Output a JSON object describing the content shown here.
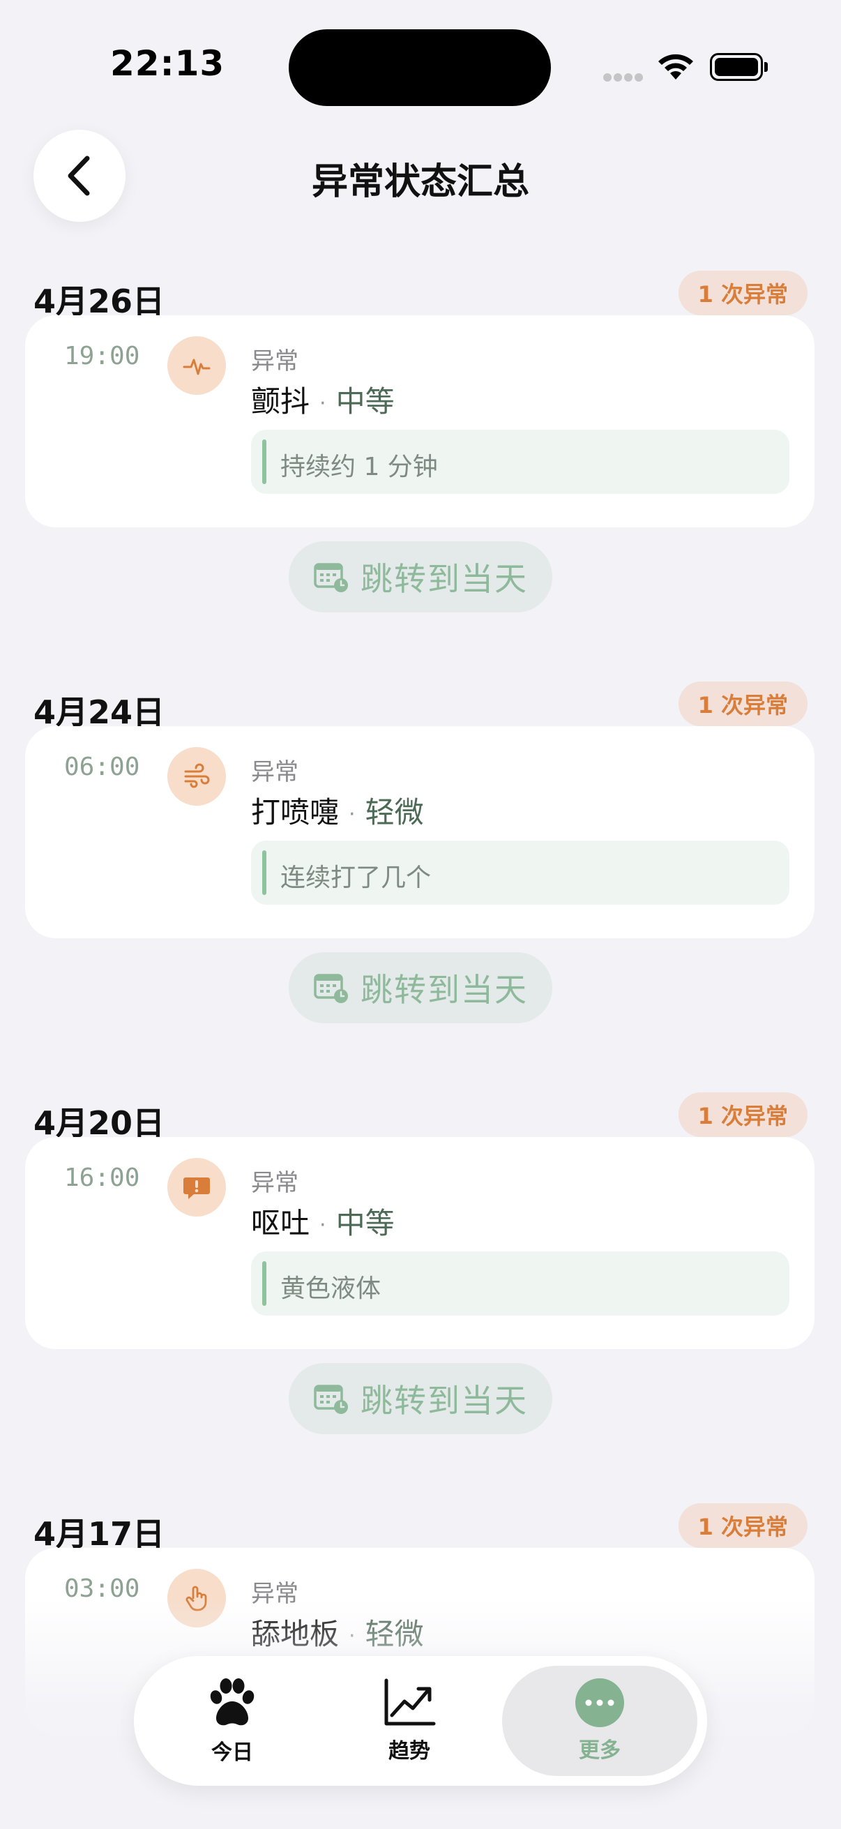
{
  "status_bar": {
    "time": "22:13"
  },
  "header": {
    "title": "异常状态汇总"
  },
  "sections": [
    {
      "date": "4月26日",
      "badge": "1 次异常",
      "time": "19:00",
      "icon": "heartbeat-icon",
      "category": "异常",
      "title": "颤抖",
      "severity": "中等",
      "note": "持续约 1 分钟",
      "jump_label": "跳转到当天"
    },
    {
      "date": "4月24日",
      "badge": "1 次异常",
      "time": "06:00",
      "icon": "wind-icon",
      "category": "异常",
      "title": "打喷嚏",
      "severity": "轻微",
      "note": "连续打了几个",
      "jump_label": "跳转到当天"
    },
    {
      "date": "4月20日",
      "badge": "1 次异常",
      "time": "16:00",
      "icon": "alert-bubble-icon",
      "category": "异常",
      "title": "呕吐",
      "severity": "中等",
      "note": "黄色液体",
      "jump_label": "跳转到当天"
    },
    {
      "date": "4月17日",
      "badge": "1 次异常",
      "time": "03:00",
      "icon": "hand-pointer-icon",
      "category": "异常",
      "title": "舔地板",
      "severity": "轻微"
    }
  ],
  "tab_bar": {
    "today": "今日",
    "trends": "趋势",
    "more": "更多"
  },
  "colors": {
    "accent_green": "#85b291",
    "warning_orange": "#d97e3a",
    "badge_bg": "#f3e0d8",
    "background": "#f2f2f7"
  }
}
